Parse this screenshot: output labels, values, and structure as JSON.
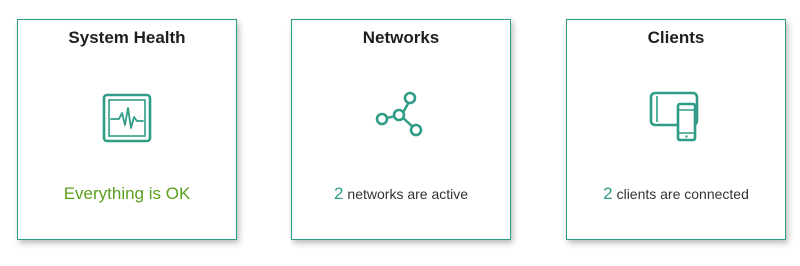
{
  "colors": {
    "accent": "#2e9c86",
    "ok": "#5a9e1e",
    "text": "#333333"
  },
  "cards": [
    {
      "title": "System Health",
      "icon": "heartbeat-monitor-icon",
      "status": "Everything is OK"
    },
    {
      "title": "Networks",
      "icon": "network-nodes-icon",
      "count": "2",
      "status": "networks are active"
    },
    {
      "title": "Clients",
      "icon": "devices-icon",
      "count": "2",
      "status": "clients are connected"
    }
  ]
}
